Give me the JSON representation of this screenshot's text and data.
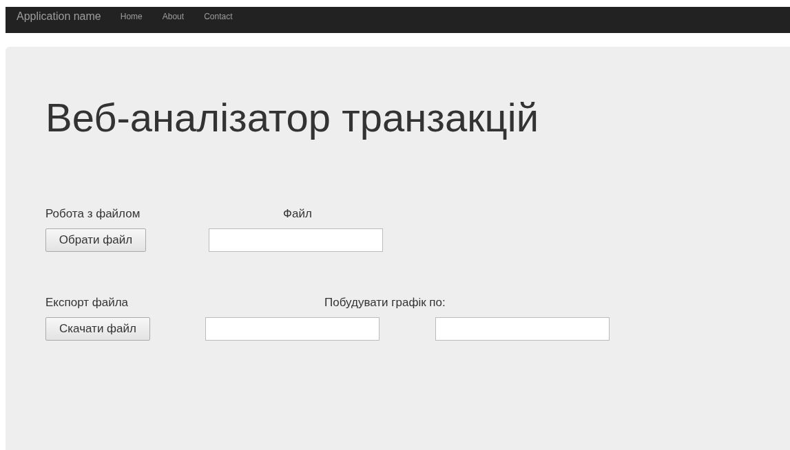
{
  "navbar": {
    "brand": "Application name",
    "links": [
      "Home",
      "About",
      "Contact"
    ]
  },
  "title": "Веб-аналізатор транзакцій",
  "file_section": {
    "label": "Робота з файлом",
    "file_label": "Файл",
    "button": "Обрати файл"
  },
  "export_section": {
    "label": "Експорт файла",
    "chart_label": "Побудувати графік по:",
    "button": "Скачати файл"
  }
}
